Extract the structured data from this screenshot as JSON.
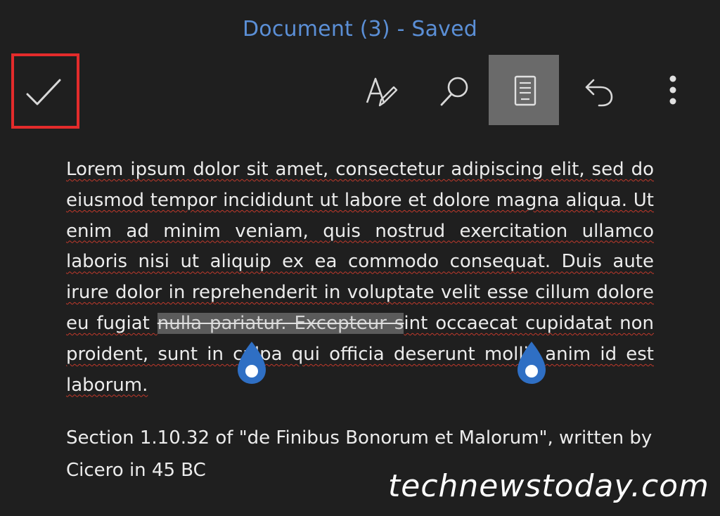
{
  "header": {
    "title": "Document (3) - Saved",
    "accent_color": "#5b8fd6",
    "highlight_color": "#e32b2b"
  },
  "toolbar": {
    "confirm_icon": "checkmark-icon",
    "tools": [
      {
        "icon": "text-format-pen-icon",
        "active": false
      },
      {
        "icon": "search-icon",
        "active": false
      },
      {
        "icon": "reading-mode-icon",
        "active": true
      },
      {
        "icon": "undo-icon",
        "active": false
      },
      {
        "icon": "more-vertical-icon",
        "active": false
      }
    ]
  },
  "document": {
    "p1_before_selection": "Lorem ipsum dolor sit amet, consectetur adipiscing elit, sed do eiusmod tempor incididunt ut labore et dolore magna aliqua. Ut enim ad minim veniam, quis nostrud exercitation ullamco laboris nisi ut aliquip ex ea commodo consequat. Duis aute irure dolor in reprehenderit in voluptate velit esse cillum dolore eu fugiat ",
    "selected_text": "nulla pariatur. Excepteur s",
    "p1_after_selection": "int occaecat cupidatat non proident, sunt in culpa qui officia deserunt mollit anim id est laborum.",
    "p2": "Section 1.10.32 of \"de Finibus Bonorum et Malorum\", written by Cicero in 45 BC",
    "selection_handle_color": "#2f6fc4"
  },
  "watermark": "technewstoday.com"
}
